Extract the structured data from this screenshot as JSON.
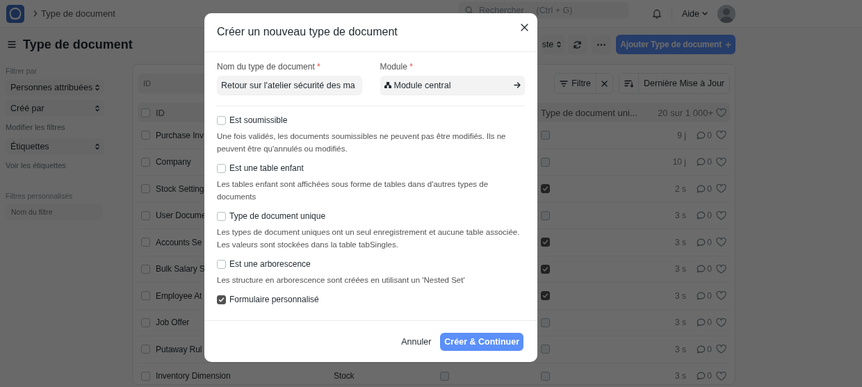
{
  "topbar": {
    "breadcrumb": "Type de document",
    "search": {
      "placeholder": "Rechercher",
      "shortcut": "(Ctrl + G)"
    },
    "help": "Aide"
  },
  "page_header": {
    "title": "Type de document",
    "view_button": "ste",
    "add_button": "Ajouter Type de document"
  },
  "sidebar": {
    "filter_heading": "Filtrer par",
    "filters": [
      {
        "label": "Personnes attribuées"
      },
      {
        "label": "Créé par"
      }
    ],
    "edit_filters_link": "Modifier les filtres",
    "tags_select": "Étiquettes",
    "show_tags_link": "Voir les étiquettes",
    "custom_filters_heading": "Filtres personnalisés",
    "filter_name": {
      "placeholder": "Nom du filtre"
    }
  },
  "list": {
    "id_filter": {
      "placeholder": "ID"
    },
    "filter_button": "Filtre",
    "sort_button": "Dernière Mise à Jour",
    "all_selected": false,
    "columns": [
      "ID",
      "Type de document uni..."
    ],
    "count": "20 sur 1 000+",
    "rows": [
      {
        "id": "Purchase Inv",
        "selected": false,
        "single": false,
        "modified": "9 j",
        "comments": "0"
      },
      {
        "id": "Company",
        "selected": false,
        "single": false,
        "modified": "10 j",
        "comments": "0"
      },
      {
        "id": "Stock Setting",
        "selected": false,
        "single": true,
        "modified": "2 s",
        "comments": "0"
      },
      {
        "id": "User Docume",
        "selected": false,
        "single": false,
        "modified": "3 s",
        "comments": "0"
      },
      {
        "id": "Accounts Se",
        "selected": false,
        "single": true,
        "modified": "3 s",
        "comments": "0"
      },
      {
        "id": "Bulk Salary S",
        "selected": false,
        "single": true,
        "modified": "3 s",
        "comments": "0"
      },
      {
        "id": "Employee At",
        "selected": false,
        "single": true,
        "modified": "3 s",
        "comments": "0"
      },
      {
        "id": "Job Offer",
        "selected": false,
        "single": false,
        "modified": "3 s",
        "comments": "0"
      },
      {
        "id": "Putaway Rul",
        "selected": false,
        "single": false,
        "modified": "3 s",
        "comments": "0"
      },
      {
        "id": "Inventory Dimension",
        "selected": false,
        "module": "Stock",
        "child_table": false,
        "single": false,
        "modified": "3 s",
        "comments": "0"
      }
    ]
  },
  "dialog": {
    "title": "Créer un nouveau type de document",
    "name_label": "Nom du type de document",
    "name_required": "*",
    "name_value": "Retour sur l'atelier sécurité des ma",
    "module_label": "Module",
    "module_required": "*",
    "module_value": "Module central",
    "options": [
      {
        "label": "Est soumissible",
        "checked": false,
        "description": "Une fois validés, les documents soumissibles ne peuvent pas être modifiés. Ils ne peuvent être qu'annulés ou modifiés."
      },
      {
        "label": "Est une table enfant",
        "checked": false,
        "description": "Les tables enfant sont affichées sous forme de tables dans d'autres types de documents"
      },
      {
        "label": "Type de document unique",
        "checked": false,
        "description": "Les types de document uniques ont un seul enregistrement et aucune table associée. Les valeurs sont stockées dans la table tabSingles."
      },
      {
        "label": "Est une arborescence",
        "checked": false,
        "description": "Les structure en arborescence sont créées en utilisant un 'Nested Set'"
      },
      {
        "label": "Formulaire personnalisé",
        "checked": true
      }
    ],
    "cancel_button": "Annuler",
    "primary_button": "Créer & Continuer"
  }
}
